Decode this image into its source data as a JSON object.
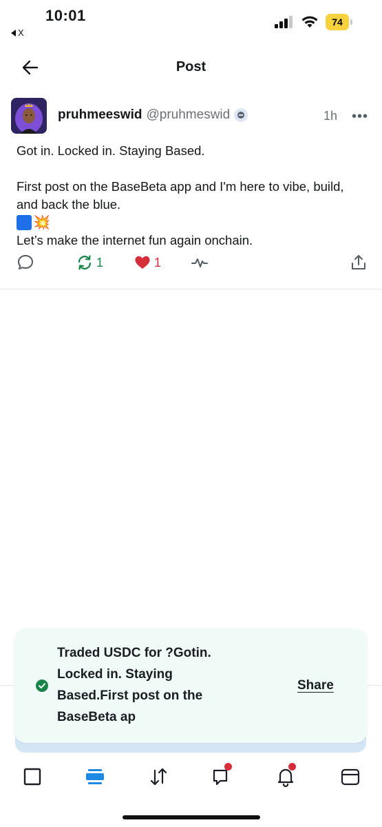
{
  "status_bar": {
    "time": "10:01",
    "back_app_label": "X",
    "battery_level": "74",
    "battery_color": "#f7d23e"
  },
  "header": {
    "title": "Post",
    "back_icon": "arrow-left-icon"
  },
  "post": {
    "author_name": "pruhmeeswid",
    "author_handle": "@pruhmeswid",
    "time": "1h",
    "more_icon": "•••",
    "body_line_1": "Got in. Locked in. Staying Based.",
    "body_line_2": "First post on the BaseBeta app and I'm here to vibe, build, and back the blue.",
    "body_emoji_burst": "💥",
    "body_line_3": "Let’s make the internet fun again onchain.",
    "actions": {
      "reply_icon": "comment-icon",
      "recast_icon": "recast-icon",
      "recast_count": "1",
      "like_icon": "heart-icon",
      "like_count": "1",
      "analytics_icon": "pulse-icon",
      "share_icon": "share-upload-icon"
    }
  },
  "toast": {
    "message": "Traded USDC for ?Gotin. Locked in. Staying Based.First post on the BaseBeta ap",
    "share_label": "Share",
    "status_icon": "check-circle-icon",
    "accent_color": "#17854a"
  },
  "bottom_nav": {
    "items": [
      {
        "name": "home",
        "icon": "square-icon"
      },
      {
        "name": "feed",
        "icon": "feed-icon",
        "active": true
      },
      {
        "name": "trade",
        "icon": "swap-arrows-icon"
      },
      {
        "name": "chat",
        "icon": "chat-icon",
        "badge": true
      },
      {
        "name": "notifications",
        "icon": "bell-icon",
        "badge": true
      },
      {
        "name": "wallet",
        "icon": "wallet-icon"
      }
    ],
    "active_color": "#1e88e5",
    "badge_color": "#d62d3a"
  }
}
